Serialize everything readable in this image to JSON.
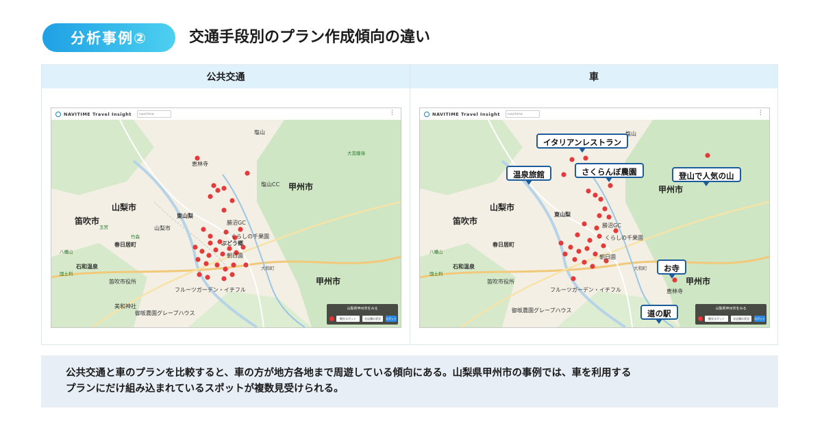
{
  "header": {
    "badge": "分析事例②",
    "title": "交通手段別のプラン作成傾向の違い"
  },
  "columns": [
    {
      "label": "公共交通",
      "app_name": "NAVITIME Travel Insight",
      "search_text": "navitime",
      "map_labels": [
        "恵林寺",
        "山梨市",
        "笛吹市",
        "東山梨",
        "甲州市",
        "山梨市",
        "春日居町",
        "勝沼GC",
        "ぶどう郷",
        "朝日園",
        "甲州市",
        "石和温泉",
        "笛吹市役所",
        "フルーツガーデン・イチフル",
        "美和神社",
        "御坂農園グレープハウス",
        "くらしの千果園",
        "塩山CC",
        "大和町",
        "塩山",
        "八幡山",
        "大菩薩嶺",
        "国土利",
        "玉宮",
        "竹森"
      ],
      "info_panel": {
        "title": "山梨県甲州市をみる",
        "button_a": "観光スポット",
        "button_b": "全店舗の状況",
        "button_c": "スポット"
      }
    },
    {
      "label": "車",
      "app_name": "NAVITIME Travel Insight",
      "search_text": "navitime",
      "map_labels": [
        "山梨市",
        "笛吹市",
        "東山梨",
        "甲州市",
        "春日居町",
        "勝沼GC",
        "朝日園",
        "甲州市",
        "石和温泉",
        "笛吹市役所",
        "フルーツガーデン・イチフル",
        "御坂農園グレープハウス",
        "くらしの千果園",
        "大和町",
        "塩山",
        "八幡山",
        "国土利",
        "恵林寺"
      ],
      "callouts": [
        "イタリアンレストラン",
        "温泉旅館",
        "さくらんぼ農園",
        "登山で人気の山",
        "お寺",
        "道の駅"
      ],
      "info_panel": {
        "title": "山梨県甲州市をみる",
        "button_a": "観光スポット",
        "button_b": "全店舗の状況",
        "button_c": "スポット"
      }
    }
  ],
  "summary": {
    "line1": "公共交通と車のプランを比較すると、車の方が地方各地まで周遊している傾向にある。山梨県甲州市の事例では、車を利用する",
    "line2": "プランにだけ組み込まれているスポットが複数見受けられる。"
  },
  "colors": {
    "accent": "#1fa0e4",
    "pin": "#e23b3b",
    "callout_border": "#1d5c9c",
    "header_bg": "#dff1fa",
    "summary_bg": "#e7eef5"
  }
}
